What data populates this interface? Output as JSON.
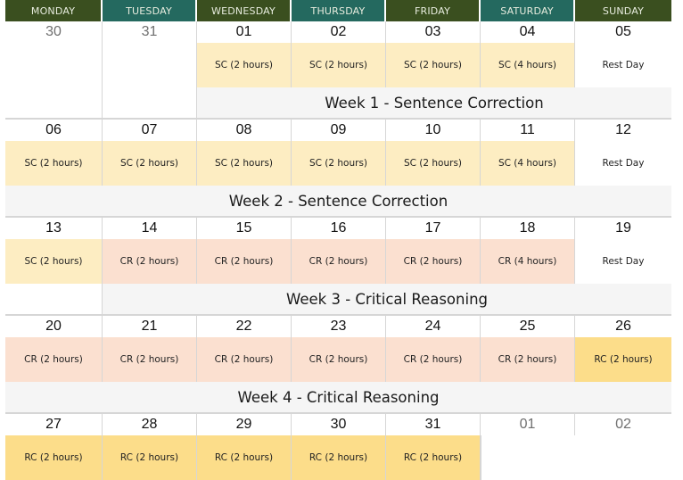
{
  "headers": [
    "MONDAY",
    "TUESDAY",
    "WEDNESDAY",
    "THURSDAY",
    "FRIDAY",
    "SATURDAY",
    "SUNDAY"
  ],
  "colors": {
    "header_dark": "#3a4f1f",
    "header_teal": "#24695f",
    "sc": "#fdedc2",
    "cr": "#fbe0d0",
    "rc": "#fcdd8a",
    "band": "#f5f5f5"
  },
  "weeks": [
    {
      "dates": [
        "30",
        "31",
        "01",
        "02",
        "03",
        "04",
        "05"
      ],
      "events": [
        "",
        "",
        "SC (2 hours)",
        "SC (2 hours)",
        "SC (2 hours)",
        "SC (4 hours)",
        "Rest Day"
      ],
      "band": "Week 1 - Sentence Correction"
    },
    {
      "dates": [
        "06",
        "07",
        "08",
        "09",
        "10",
        "11",
        "12"
      ],
      "events": [
        "SC (2 hours)",
        "SC (2 hours)",
        "SC (2 hours)",
        "SC (2 hours)",
        "SC (2 hours)",
        "SC (4 hours)",
        "Rest Day"
      ],
      "band": "Week 2 - Sentence Correction"
    },
    {
      "dates": [
        "13",
        "14",
        "15",
        "16",
        "17",
        "18",
        "19"
      ],
      "events": [
        "SC (2 hours)",
        "CR (2 hours)",
        "CR (2 hours)",
        "CR (2 hours)",
        "CR (2 hours)",
        "CR (4 hours)",
        "Rest Day"
      ],
      "band": "Week 3 - Critical Reasoning"
    },
    {
      "dates": [
        "20",
        "21",
        "22",
        "23",
        "24",
        "25",
        "26"
      ],
      "events": [
        "CR (2 hours)",
        "CR (2 hours)",
        "CR (2 hours)",
        "CR (2 hours)",
        "CR (2 hours)",
        "CR (2 hours)",
        "RC (2 hours)"
      ],
      "band": "Week 4 - Critical Reasoning"
    },
    {
      "dates": [
        "27",
        "28",
        "29",
        "30",
        "31",
        "01",
        "02"
      ],
      "events": [
        "RC (2 hours)",
        "RC (2 hours)",
        "RC (2 hours)",
        "RC (2 hours)",
        "RC (2 hours)",
        "",
        ""
      ]
    }
  ]
}
